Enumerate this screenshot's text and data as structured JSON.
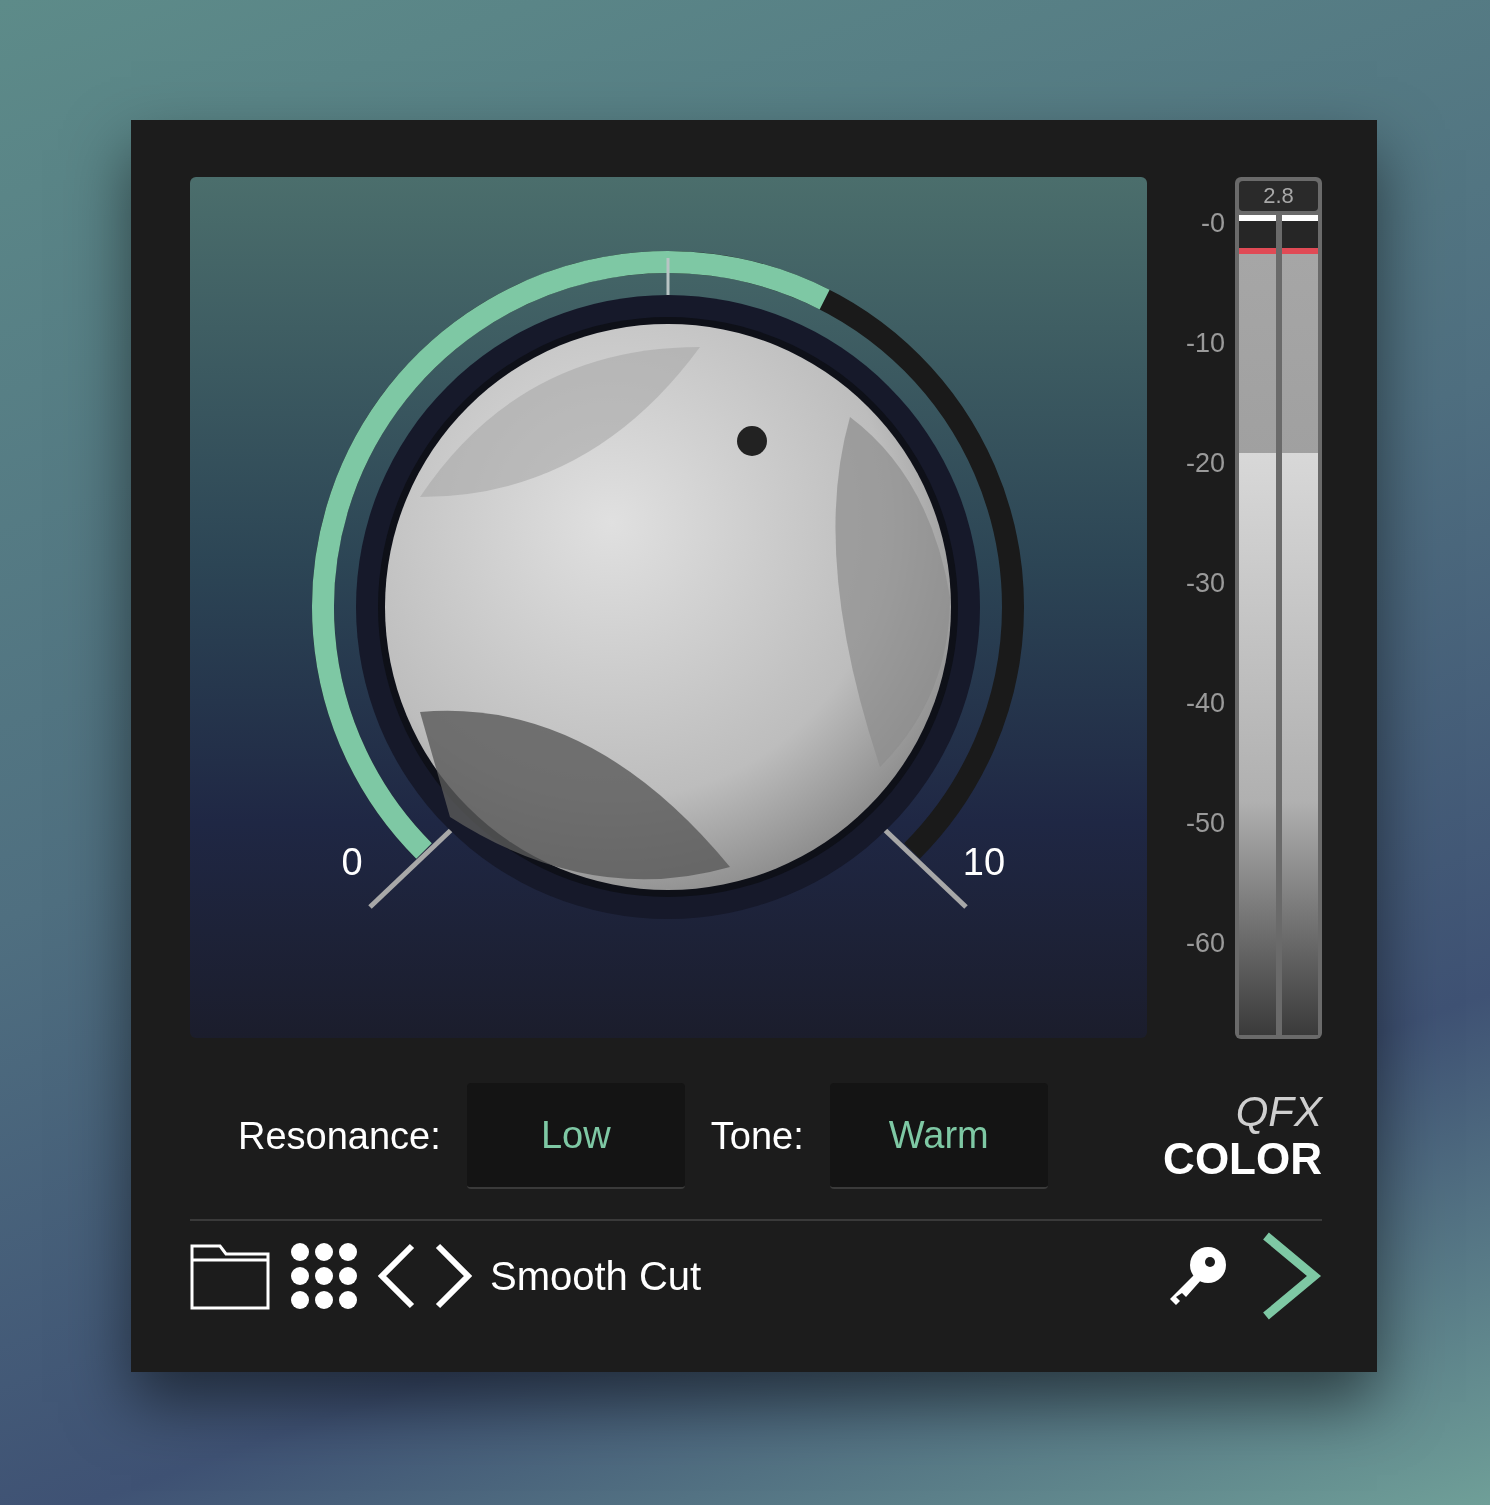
{
  "knob": {
    "min_label": "0",
    "max_label": "10"
  },
  "meter": {
    "readout": "2.8",
    "ticks": [
      "-0",
      "-10",
      "-20",
      "-30",
      "-40",
      "-50",
      "-60"
    ],
    "channels": [
      {
        "level": 0.71,
        "hold": {
          "level": 0.96
        }
      },
      {
        "level": 0.71,
        "hold": {
          "level": 0.96
        }
      }
    ]
  },
  "controls": [
    {
      "label": "Resonance:",
      "value": "Low"
    },
    {
      "label": "Tone:",
      "value": "Warm"
    }
  ],
  "logo": {
    "line_1": "QFX",
    "line_2": "COLOR"
  },
  "toolbar": {
    "preset_name": "Smooth Cut"
  }
}
